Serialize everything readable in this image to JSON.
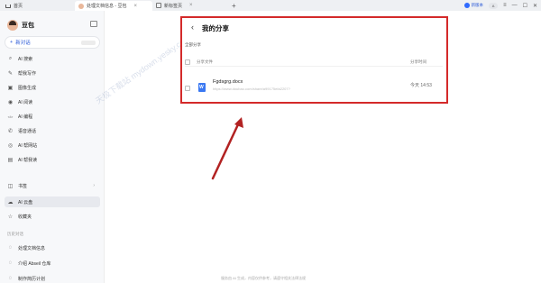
{
  "titlebar": {
    "tabs": [
      {
        "label": "首页"
      },
      {
        "label": "处理文档信息 - 豆包"
      },
      {
        "label": "新标签页"
      }
    ],
    "upgrade_label": "新版本",
    "user_initial": "A"
  },
  "sidebar": {
    "brand": "豆包",
    "new_chat": "新对话",
    "items": [
      {
        "icon": "search-icon",
        "glyph": "⌕",
        "label": "AI 搜索"
      },
      {
        "icon": "pen-icon",
        "glyph": "✎",
        "label": "帮我写作"
      },
      {
        "icon": "image-icon",
        "glyph": "▣",
        "label": "图像生成"
      },
      {
        "icon": "read-icon",
        "glyph": "◉",
        "label": "AI 阅读"
      },
      {
        "icon": "code-icon",
        "glyph": "</>",
        "label": "AI 编程"
      },
      {
        "icon": "phone-icon",
        "glyph": "✆",
        "label": "语音通话"
      },
      {
        "icon": "globe-icon",
        "glyph": "◎",
        "label": "AI 帮网站"
      },
      {
        "icon": "doc-icon",
        "glyph": "▤",
        "label": "AI 帮我读"
      },
      {
        "icon": "book-icon",
        "glyph": "◫",
        "label": "书签"
      },
      {
        "icon": "cloud-icon",
        "glyph": "☁",
        "label": "AI 云盘"
      },
      {
        "icon": "star-icon",
        "glyph": "☆",
        "label": "收藏夹"
      }
    ],
    "history_label": "历史对话",
    "history": [
      {
        "label": "处理文档信息"
      },
      {
        "label": "介绍 Abseil 仓库"
      },
      {
        "label": "制作简历计划"
      }
    ]
  },
  "main": {
    "back_glyph": "‹",
    "title": "我的分享",
    "subtitle": "全部分享",
    "col_file": "分享文件",
    "col_time": "分享时间",
    "files": [
      {
        "name": "Fgdsgrg.docx",
        "link": "https://www.doubao.com/share/a99175efa2207?",
        "time": "今天 14:53"
      }
    ]
  },
  "watermark": "天极下载站 mydown.yesky.com",
  "footer": "服务由 AI 生成，内容仅供参考，请遵守相关法律法规"
}
